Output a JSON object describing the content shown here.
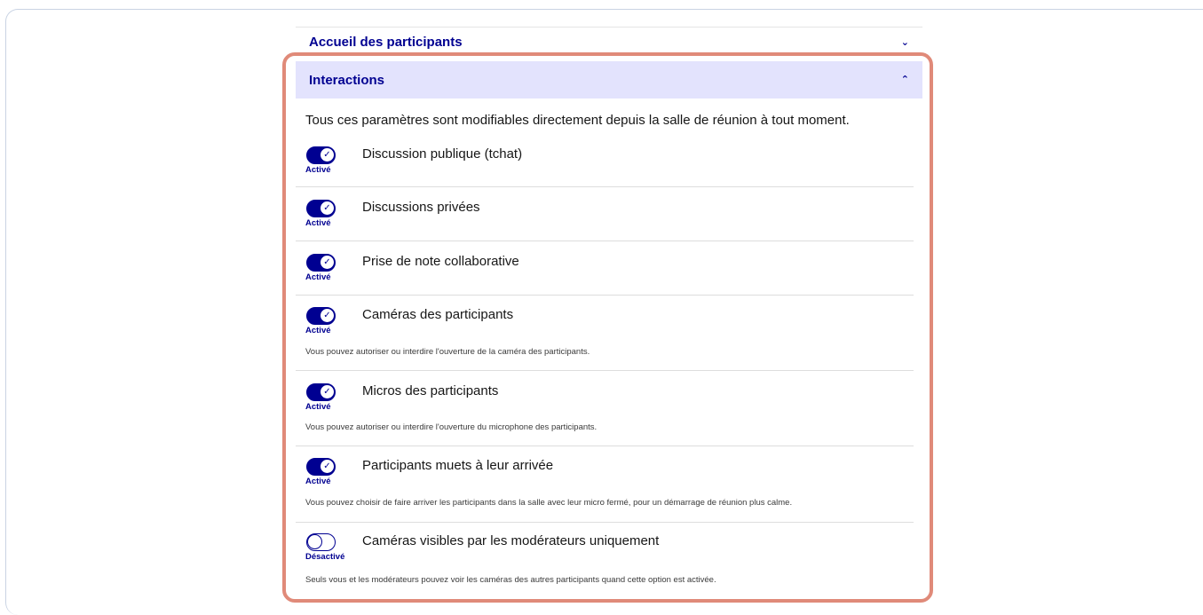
{
  "sections": {
    "accueil": {
      "title": "Accueil des participants",
      "expanded": false
    },
    "interactions": {
      "title": "Interactions",
      "expanded": true,
      "intro": "Tous ces paramètres sont modifiables directement depuis la salle de réunion à tout moment."
    }
  },
  "icons": {
    "collapsed": "chevron-down-icon",
    "expanded": "chevron-up-icon",
    "toggle_on": "check-icon"
  },
  "colors": {
    "accent": "#000091",
    "header_bg": "#e3e3fd",
    "highlight_border": "#e08a79"
  },
  "settings": [
    {
      "label": "Discussion publique (tchat)",
      "enabled": true,
      "state": "Activé",
      "description": ""
    },
    {
      "label": "Discussions privées",
      "enabled": true,
      "state": "Activé",
      "description": ""
    },
    {
      "label": "Prise de note collaborative",
      "enabled": true,
      "state": "Activé",
      "description": ""
    },
    {
      "label": "Caméras des participants",
      "enabled": true,
      "state": "Activé",
      "description": "Vous pouvez autoriser ou interdire l'ouverture de la caméra des participants."
    },
    {
      "label": "Micros des participants",
      "enabled": true,
      "state": "Activé",
      "description": "Vous pouvez autoriser ou interdire l'ouverture du microphone des participants."
    },
    {
      "label": "Participants muets à leur arrivée",
      "enabled": true,
      "state": "Activé",
      "description": "Vous pouvez choisir de faire arriver les participants dans la salle avec leur micro fermé, pour un démarrage de réunion plus calme."
    },
    {
      "label": "Caméras visibles par les modérateurs uniquement",
      "enabled": false,
      "state": "Désactivé",
      "description": "Seuls vous et les modérateurs pouvez voir les caméras des autres participants quand cette option est activée."
    }
  ]
}
